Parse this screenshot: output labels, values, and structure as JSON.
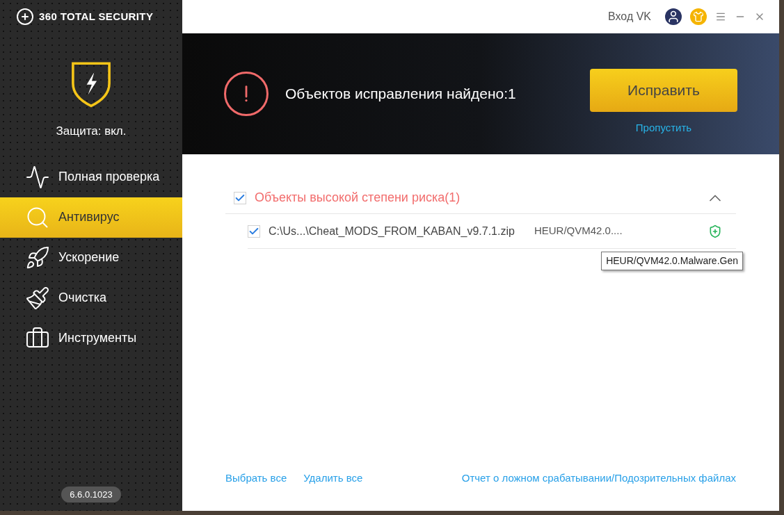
{
  "app": {
    "logo_text": "360 TOTAL SECURITY",
    "protection_status": "Защита: вкл.",
    "version": "6.6.0.1023"
  },
  "sidebar": {
    "items": [
      {
        "label": "Полная проверка",
        "selected": false
      },
      {
        "label": "Антивирус",
        "selected": true
      },
      {
        "label": "Ускорение",
        "selected": false
      },
      {
        "label": "Очистка",
        "selected": false
      },
      {
        "label": "Инструменты",
        "selected": false
      }
    ]
  },
  "titlebar": {
    "login": "Вход VK"
  },
  "banner": {
    "message": "Объектов исправления найдено:1",
    "fix_button": "Исправить",
    "skip_link": "Пропустить"
  },
  "group": {
    "title": "Объекты высокой степени риска(1)",
    "checked": true,
    "expanded": true,
    "items": [
      {
        "path": "C:\\Us...\\Cheat_MODS_FROM_KABAN_v9.7.1.zip",
        "threat": "HEUR/QVM42.0....",
        "checked": true,
        "tooltip": "HEUR/QVM42.0.Malware.Gen"
      }
    ]
  },
  "footer": {
    "links": [
      "Выбрать все",
      "Удалить все",
      "Отчет о ложном срабатывании/Подозрительных файлах"
    ]
  }
}
